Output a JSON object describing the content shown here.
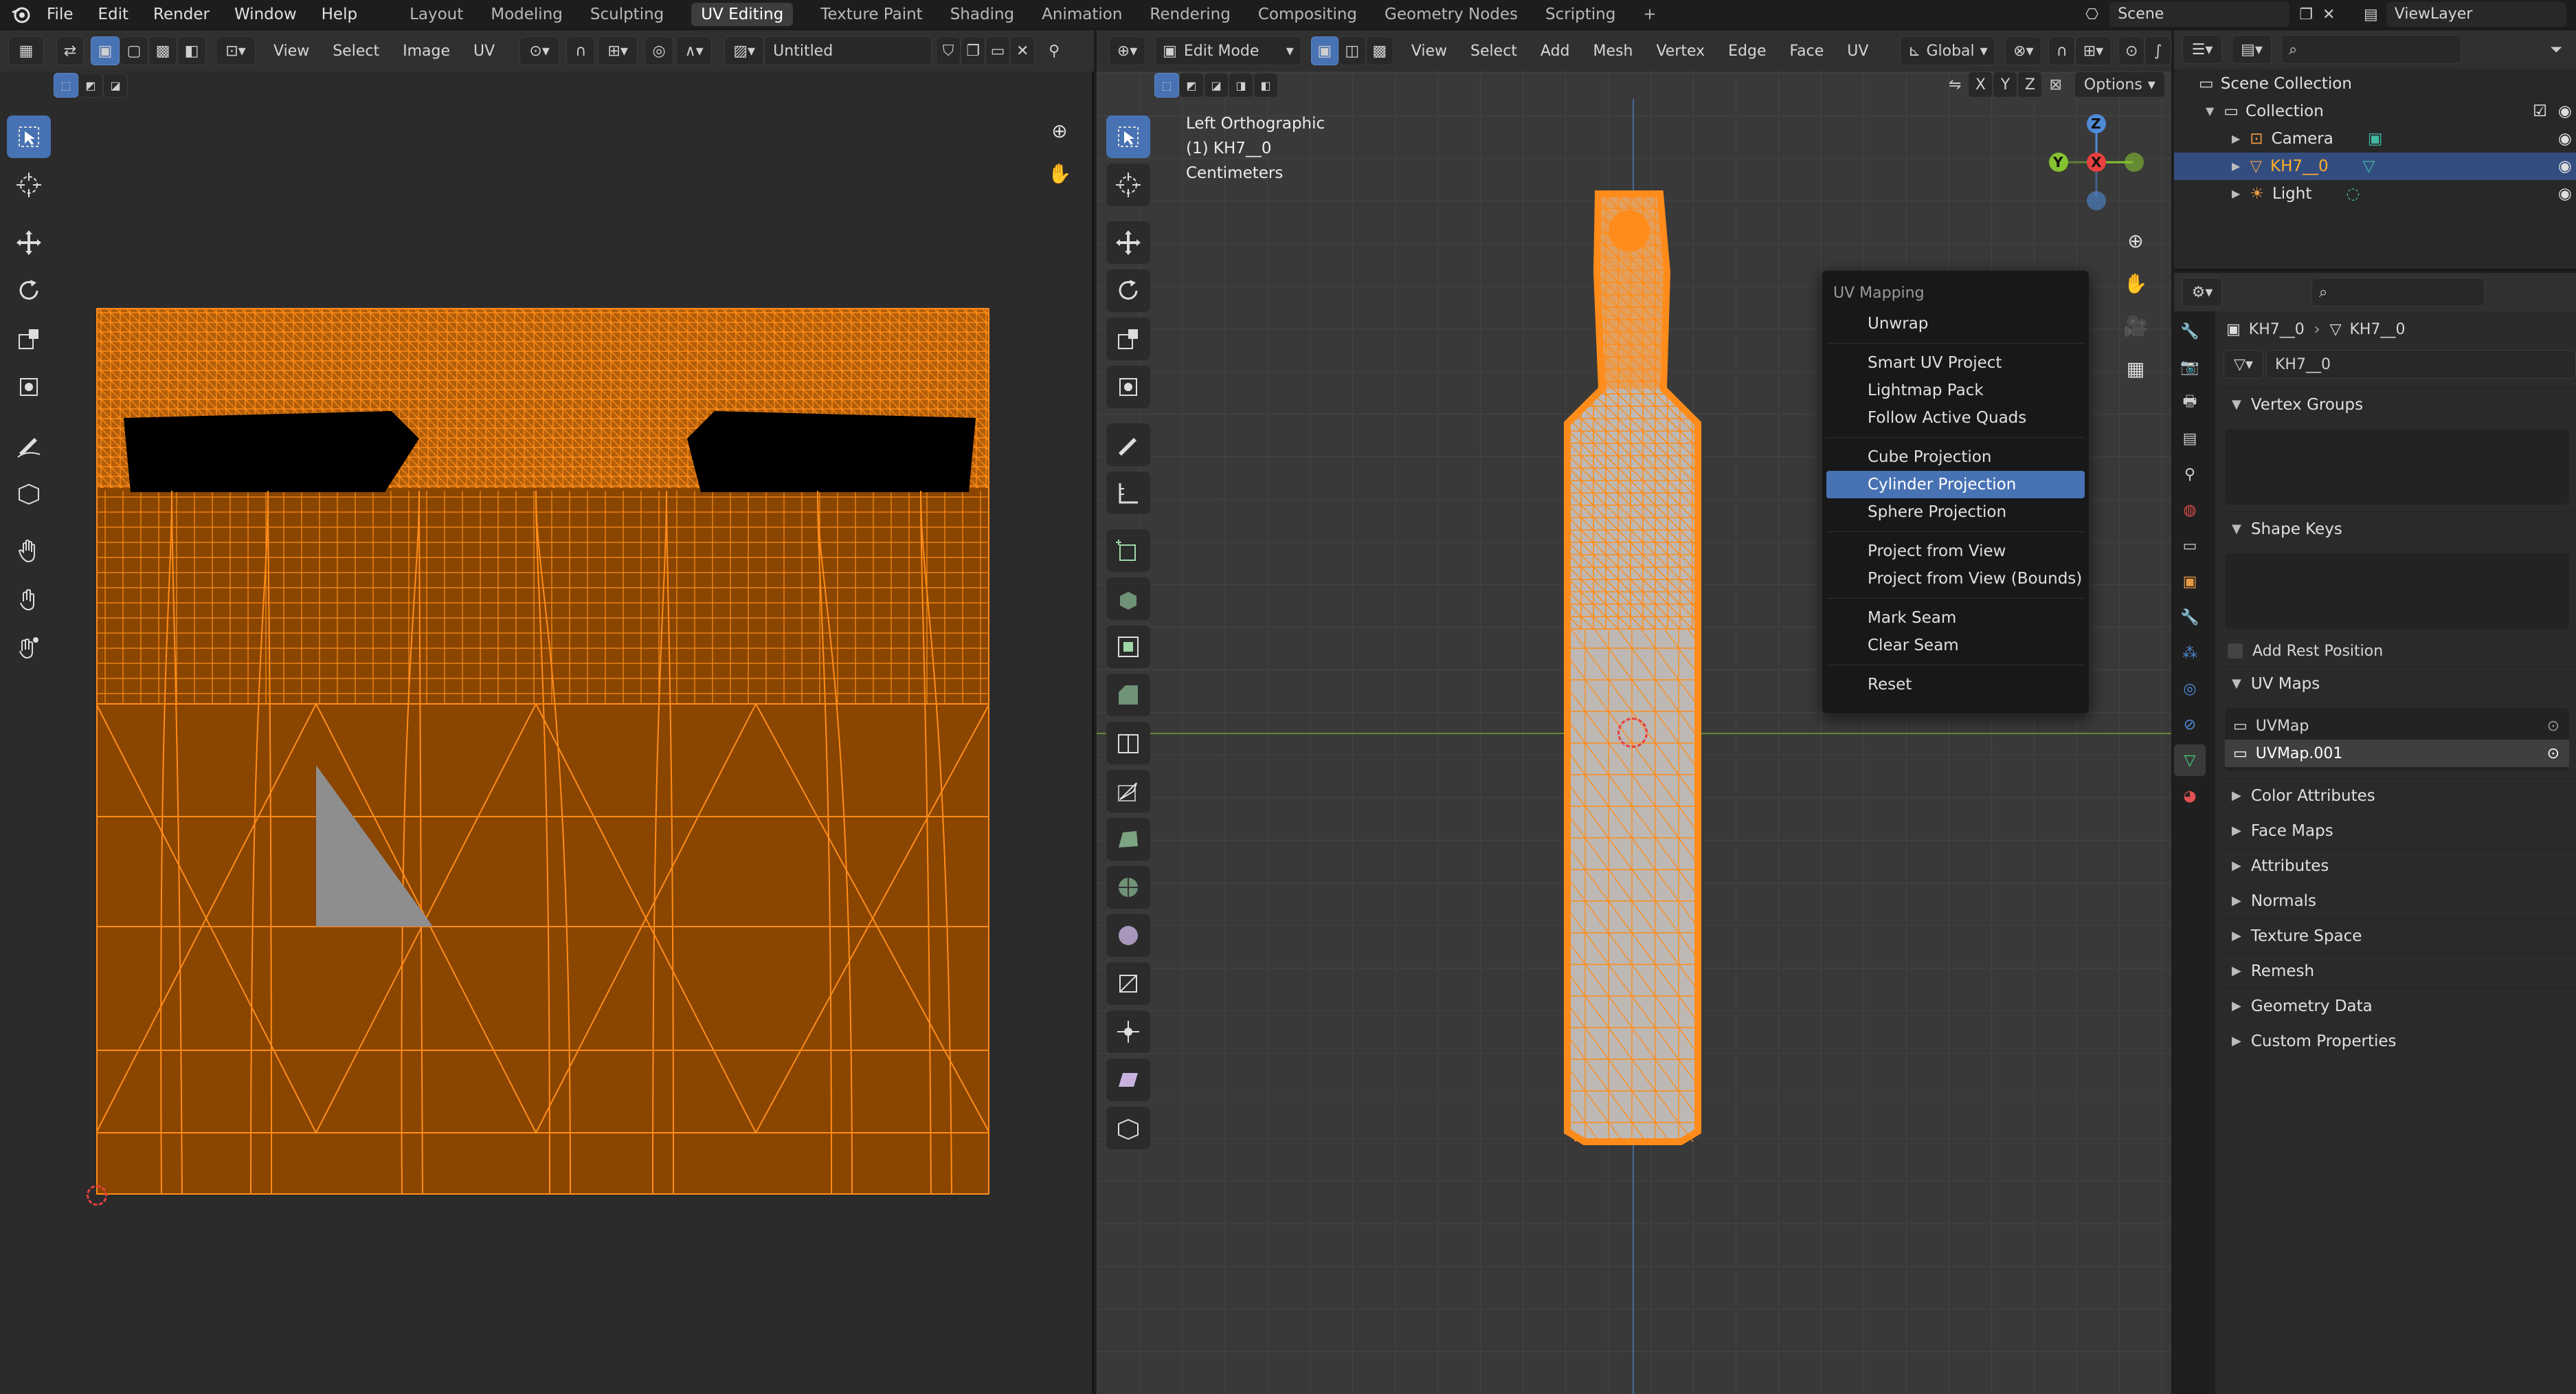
{
  "topbar": {
    "menus": [
      "File",
      "Edit",
      "Render",
      "Window",
      "Help"
    ],
    "workspaces": [
      "Layout",
      "Modeling",
      "Sculpting",
      "UV Editing",
      "Texture Paint",
      "Shading",
      "Animation",
      "Rendering",
      "Compositing",
      "Geometry Nodes",
      "Scripting"
    ],
    "active_workspace": "UV Editing",
    "add_tab": "+",
    "scene": "Scene",
    "view_layer": "ViewLayer"
  },
  "uv_editor": {
    "menus": [
      "View",
      "Select",
      "Image",
      "UV"
    ],
    "image_name": "Untitled"
  },
  "viewport": {
    "mode": "Edit Mode",
    "menus": [
      "View",
      "Select",
      "Add",
      "Mesh",
      "Vertex",
      "Edge",
      "Face",
      "UV"
    ],
    "transform_orientation": "Global",
    "axis_x": "X",
    "axis_y": "Y",
    "axis_z": "Z",
    "options_label": "Options",
    "view_name": "Left Orthographic",
    "object_label": "(1) KH7__0",
    "units": "Centimeters",
    "gizmo": {
      "x": "X",
      "y": "Y",
      "z": "Z"
    }
  },
  "context_menu": {
    "title": "UV Mapping",
    "groups": [
      [
        "Unwrap"
      ],
      [
        "Smart UV Project",
        "Lightmap Pack",
        "Follow Active Quads"
      ],
      [
        "Cube Projection",
        "Cylinder Projection",
        "Sphere Projection"
      ],
      [
        "Project from View",
        "Project from View (Bounds)"
      ],
      [
        "Mark Seam",
        "Clear Seam"
      ],
      [
        "Reset"
      ]
    ],
    "highlighted": "Cylinder Projection"
  },
  "outliner": {
    "root": "Scene Collection",
    "collection": "Collection",
    "items": [
      "Camera",
      "KH7__0",
      "Light"
    ],
    "selected": "KH7__0"
  },
  "properties": {
    "breadcrumb_object": "KH7__0",
    "breadcrumb_data": "KH7__0",
    "mesh_name": "KH7__0",
    "panels": {
      "vertex_groups": "Vertex Groups",
      "shape_keys": "Shape Keys",
      "add_rest_position": "Add Rest Position",
      "uv_maps": "UV Maps"
    },
    "uv_maps": [
      "UVMap",
      "UVMap.001"
    ],
    "collapsed_panels": [
      "Color Attributes",
      "Face Maps",
      "Attributes",
      "Normals",
      "Texture Space",
      "Remesh",
      "Geometry Data",
      "Custom Properties"
    ]
  },
  "colors": {
    "accent": "#4772b3",
    "selection_orange": "#ff8c1a",
    "uv_fill": "#8a4500",
    "axis_x": "#e8403f",
    "axis_y": "#85c230",
    "axis_z": "#4f8ad6"
  }
}
